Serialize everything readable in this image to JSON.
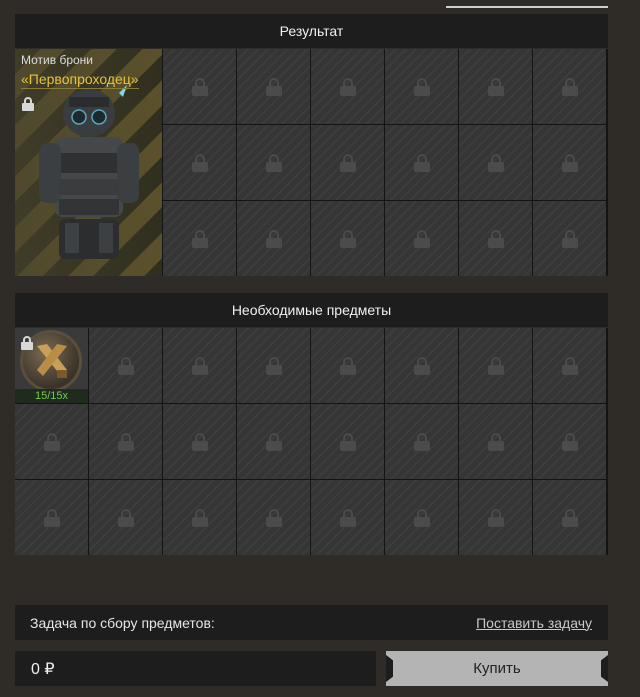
{
  "result": {
    "header": "Результат",
    "featured": {
      "type": "Мотив брони",
      "name": "«Первопроходец»"
    }
  },
  "required": {
    "header": "Необходимые предметы",
    "item": {
      "count": "15/15x"
    }
  },
  "task": {
    "label": "Задача по сбору предметов:",
    "link": "Поставить задачу"
  },
  "price": {
    "value": "0 ₽"
  },
  "buy": {
    "label": "Купить"
  }
}
